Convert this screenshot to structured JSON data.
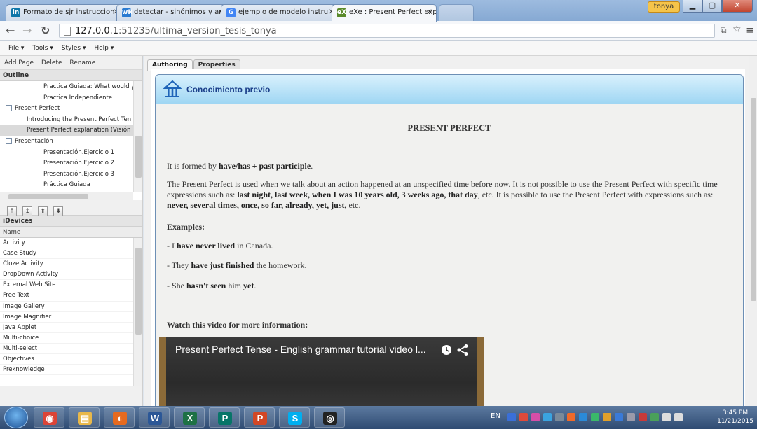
{
  "browser": {
    "tabs": [
      {
        "label": "Formato de sjr instruccion",
        "favicon": "linkedin-icon",
        "color": "#0e76a8",
        "glyph": "in"
      },
      {
        "label": "detectar - sinónimos y an",
        "favicon": "wordreference-icon",
        "color": "#2b7bd1",
        "glyph": "wR"
      },
      {
        "label": "ejemplo de modelo instru",
        "favicon": "google-icon",
        "color": "#4285f4",
        "glyph": "G"
      },
      {
        "label": "eXe : Present Perfect expl",
        "favicon": "exe-icon",
        "color": "#5a8a2a",
        "glyph": "eX"
      }
    ],
    "user_badge": "tonya",
    "url_host": "127.0.0.1",
    "url_path": ":51235/ultima_version_tesis_tonya"
  },
  "app_menu": [
    "File ▾",
    "Tools ▾",
    "Styles ▾",
    "Help ▾"
  ],
  "left": {
    "page_actions": [
      "Add Page",
      "Delete",
      "Rename"
    ],
    "outline_heading": "Outline",
    "outline_items": [
      {
        "label": "Practica Guiada: What would you",
        "level": 3,
        "selected": false
      },
      {
        "label": "Practica Independiente",
        "level": 3,
        "selected": false
      },
      {
        "label": "Present Perfect",
        "level": 1,
        "selected": false,
        "expander": "⊟"
      },
      {
        "label": "Introducing the Present Perfect Ten",
        "level": 2,
        "selected": false
      },
      {
        "label": "Present Perfect explanation (Visión",
        "level": 2,
        "selected": true
      },
      {
        "label": "Presentación",
        "level": 1,
        "selected": false,
        "expander": "⊟"
      },
      {
        "label": "Presentación.Ejercicio 1",
        "level": 3,
        "selected": false
      },
      {
        "label": "Presentación.Ejercicio 2",
        "level": 3,
        "selected": false
      },
      {
        "label": "Presentación.Ejercicio 3",
        "level": 3,
        "selected": false
      },
      {
        "label": "Práctica Guiada",
        "level": 3,
        "selected": false
      },
      {
        "label": "Practica Independiente",
        "level": 3,
        "selected": false
      }
    ],
    "idevices_heading": "iDevices",
    "idevices_col": "Name",
    "idevices": [
      "Activity",
      "Case Study",
      "Cloze Activity",
      "DropDown Activity",
      "External Web Site",
      "Free Text",
      "Image Gallery",
      "Image Magnifier",
      "Java Applet",
      "Multi-choice",
      "Multi-select",
      "Objectives",
      "Preknowledge"
    ]
  },
  "right": {
    "tabs": [
      "Authoring",
      "Properties"
    ],
    "idevice_title": "Conocimiento previo",
    "page_heading": "PRESENT PERFECT",
    "formed_by": {
      "pre": "It is formed by ",
      "bold": "have/has + past participle",
      "post": "."
    },
    "para1": {
      "t1": "The Present Perfect is used when we talk about an action happened at an unspecified time before now. It is not possible to use the Present Perfect with specific time expressions such as: ",
      "b1": "last night, last week, when I was 10 years old, 3 weeks ago, that day",
      "t2": ", etc. It is possible to use the Present Perfect with expressions such as: ",
      "b2": "never, several times, once, so far, already, yet, just,",
      "t3": " etc."
    },
    "examples_label": "Examples:",
    "ex1": {
      "pre": "- I ",
      "bold": "have never lived",
      "post": " in Canada."
    },
    "ex2": {
      "pre": "- They ",
      "bold": "have just finished",
      "post": " the homework."
    },
    "ex3": {
      "pre": "- She ",
      "bold": "hasn't seen",
      "mid": " him ",
      "bold2": "yet",
      "post": "."
    },
    "watch_label": "Watch this video for more information:",
    "video_title": "Present Perfect Tense - English grammar tutorial video l..."
  },
  "taskbar": {
    "apps": [
      {
        "name": "chrome-taskbar-icon",
        "glyph": "◉",
        "color": "#db4437"
      },
      {
        "name": "explorer-taskbar-icon",
        "glyph": "▤",
        "color": "#e8b84a"
      },
      {
        "name": "firefox-taskbar-icon",
        "glyph": "◐",
        "color": "#e66a1f"
      },
      {
        "name": "word-taskbar-icon",
        "glyph": "W",
        "color": "#2b5797"
      },
      {
        "name": "excel-taskbar-icon",
        "glyph": "X",
        "color": "#1e7145"
      },
      {
        "name": "publisher-taskbar-icon",
        "glyph": "P",
        "color": "#077568"
      },
      {
        "name": "powerpoint-taskbar-icon",
        "glyph": "P",
        "color": "#d24726"
      },
      {
        "name": "skype-taskbar-icon",
        "glyph": "S",
        "color": "#00aff0"
      },
      {
        "name": "exe-taskbar-icon",
        "glyph": "◎",
        "color": "#222222"
      }
    ],
    "lang": "EN",
    "time": "3:45 PM",
    "date": "11/21/2015"
  }
}
